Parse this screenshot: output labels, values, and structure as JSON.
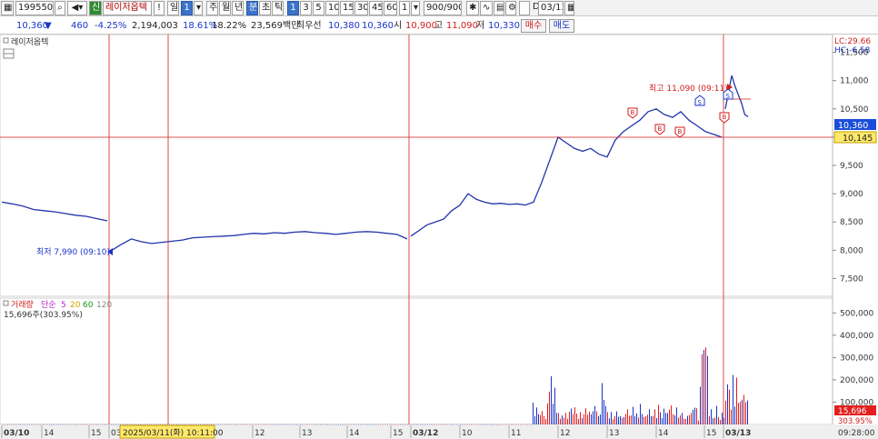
{
  "toolbar": {
    "code": "199550",
    "market_badge": "신",
    "stock_name": "레이저옵텍",
    "warn": "!",
    "day_label": "일",
    "num": "1",
    "week": "주",
    "month": "월",
    "year": "년",
    "minute": "분",
    "second": "초",
    "tick": "틱",
    "intervals": [
      "1",
      "3",
      "5",
      "10",
      "15",
      "30",
      "45",
      "60"
    ],
    "interval_input": "1",
    "count": "900/900",
    "date": "03/13"
  },
  "quote": {
    "price": "10,360",
    "change": "460",
    "change_pct": "-4.25%",
    "volume": "2,194,003",
    "turnover": "18.61%",
    "turnover2": "18.22%",
    "amount": "23,569백만",
    "best_ask_label": "최우선",
    "best_ask": "10,380",
    "best_bid": "10,360",
    "open_label": "시",
    "open": "10,900",
    "high_label": "고",
    "high": "11,090",
    "low_label": "저",
    "low": "10,330",
    "buy_label": "매수",
    "sell_label": "매도"
  },
  "price_panel": {
    "title": "레이저옵텍",
    "lc": "LC:29.66",
    "hc": "HC:-6.58",
    "y_ticks": [
      "11,500",
      "11,000",
      "10,500",
      "10,000",
      "9,500",
      "9,000",
      "8,500",
      "8,000",
      "7,500"
    ],
    "current_price": "10,360",
    "crosshair_price": "10,145",
    "high_annotation": "최고 11,090 (09:11)",
    "low_annotation": "최저 7,990 (09:10)"
  },
  "volume_panel": {
    "title": "거래량",
    "ma_label": "단순",
    "ma_periods": [
      "5",
      "20",
      "60",
      "120"
    ],
    "current": "15,696주(303.95%)",
    "y_ticks": [
      "500,000",
      "400,000",
      "300,000",
      "200,000",
      "100,000"
    ],
    "current_value": "15,696",
    "current_pct": "303.95%"
  },
  "x_axis": {
    "labels": [
      "03/10",
      "14",
      "15",
      "03",
      "12",
      "13",
      "14",
      "15",
      "03/12",
      "10",
      "11",
      "12",
      "13",
      "14",
      "15",
      "03/13"
    ],
    "crosshair_time": "2025/03/11(화) 10:11:00",
    "right_time": "09:28:00"
  },
  "chart_data": {
    "type": "line",
    "ylim": [
      7250,
      11750
    ],
    "price_sessions": [
      {
        "date": "03/10",
        "values": [
          8850,
          8820,
          8780,
          8720,
          8700,
          8680,
          8650,
          8620,
          8600,
          8560,
          8520
        ]
      },
      {
        "date": "03/11",
        "values": [
          7990,
          8100,
          8200,
          8150,
          8120,
          8140,
          8160,
          8180,
          8220,
          8230,
          8240,
          8250,
          8260,
          8280,
          8300,
          8290,
          8310,
          8300,
          8320,
          8330,
          8310,
          8300,
          8280,
          8300,
          8320,
          8330,
          8320,
          8300,
          8280,
          8200
        ]
      },
      {
        "date": "03/12",
        "values": [
          8250,
          8350,
          8450,
          8500,
          8550,
          8700,
          8800,
          9000,
          8900,
          8850,
          8820,
          8830,
          8810,
          8820,
          8800,
          8850,
          9200,
          9600,
          10000,
          9900,
          9800,
          9750,
          9800,
          9700,
          9650,
          9950,
          10100,
          10200,
          10300,
          10450,
          10500,
          10400,
          10350,
          10450,
          10300,
          10200,
          10100,
          10050,
          10000
        ]
      },
      {
        "date": "03/13",
        "values": [
          10500,
          10800,
          11090,
          10900,
          10750,
          10600,
          10400,
          10360
        ]
      }
    ],
    "volume_ylim": [
      0,
      550000
    ]
  }
}
